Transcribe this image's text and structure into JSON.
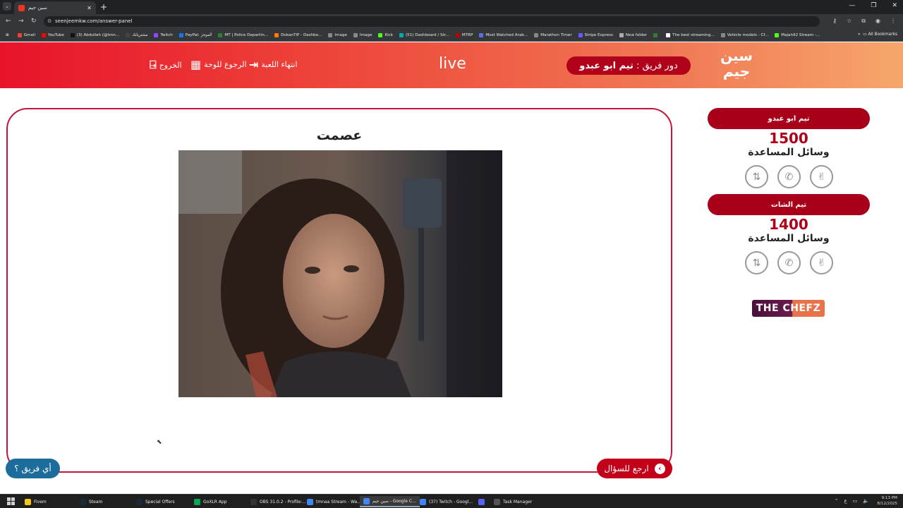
{
  "browser": {
    "tab_title": "سين جيم",
    "url": "seenjeemkw.com/answer-panel",
    "bookmarks": [
      "Gmail",
      "YouTube",
      "(3) Abdullah (@tmn...",
      "مشترياتك",
      "Twitch",
      "PayPal: الموجز",
      "MT | Police Departm...",
      "DokanTIP - Dashbo...",
      "Image",
      "Image",
      "Kick",
      "(51) Dashboard / Str...",
      "MTRP",
      "Most Watched Arab...",
      "Marathon Timer",
      "Stripe Express",
      "New folder",
      "",
      "The best streaming...",
      "Vehicle models - Cf...",
      "Majah92 Stream -..."
    ],
    "all_bookmarks": "All Bookmarks"
  },
  "header": {
    "logo": "سين جيم",
    "turn_label": "دور فريق :",
    "turn_team": "تيم ابو عبدو",
    "live": "live",
    "end_game": "انتهاء اللعبة",
    "back_board": "الرجوع للوحة",
    "exit": "الخروج"
  },
  "main": {
    "answer": "عصمت",
    "back_to_question": "ارجع للسؤال",
    "which_team": "أي فريق ؟"
  },
  "teams": [
    {
      "name": "تيم ابو عبدو",
      "score": "1500",
      "aids_label": "وسائل المساعدة"
    },
    {
      "name": "تيم الشات",
      "score": "1400",
      "aids_label": "وسائل المساعدة"
    }
  ],
  "sponsor": "THE CHEFZ",
  "taskbar": {
    "items": [
      "Fivem",
      "Steam",
      "Special Offers",
      "GoXLR App",
      "OBS 31.0.2 - Profile:...",
      "tmnaa Stream - Wa...",
      "سين جيم - Google C...",
      "(37) Twitch - Googl...",
      "",
      "Task Manager"
    ],
    "time": "9:13 PM",
    "date": "8/12/2025"
  }
}
